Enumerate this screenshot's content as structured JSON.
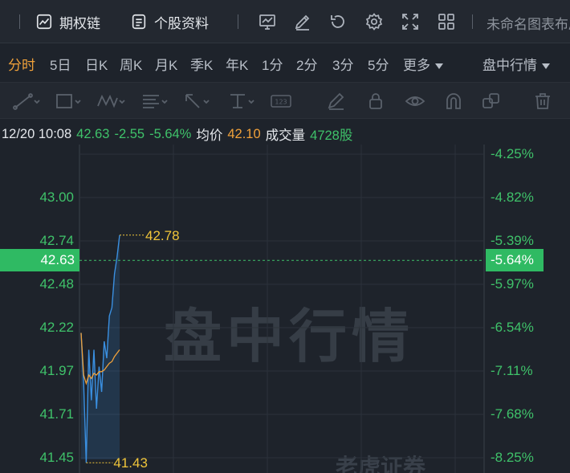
{
  "topbar": {
    "option_chain": "期权链",
    "stock_info": "个股资料",
    "layout_name": "未命名图表布局",
    "icons": [
      "chart-icon",
      "edit-icon",
      "refresh-icon",
      "settings-icon",
      "fullscreen-icon",
      "grid-icon"
    ]
  },
  "periods": {
    "items": [
      "分时",
      "5日",
      "日K",
      "周K",
      "月K",
      "季K",
      "年K",
      "1分",
      "2分",
      "3分",
      "5分",
      "更多"
    ],
    "active": "分时",
    "session": "盘中行情"
  },
  "tools": [
    "trendline-tool",
    "rectangle-tool",
    "pattern-tool",
    "fib-tool",
    "arrow-tool",
    "price-range-tool",
    "label-tool",
    "pen-tool",
    "lock-tool",
    "eye-tool",
    "magnet-tool",
    "copy-tool",
    "trash-tool"
  ],
  "info": {
    "datetime": "12/20 10:08",
    "price": "42.63",
    "change": "-2.55",
    "change_pct": "-5.64%",
    "avg_label": "均价",
    "avg_value": "42.10",
    "volume_label": "成交量",
    "volume_value": "4728股"
  },
  "watermark": "盘中行情",
  "logo_watermark": "老虎证券",
  "colors": {
    "up": "#f2525a",
    "down": "#3fc26a",
    "price_line": "#3a8fe0",
    "avg_line": "#f0a13a",
    "accent": "#f0a13a",
    "background": "#1e232b"
  },
  "chart_data": {
    "type": "line",
    "y_left_ticks": [
      "43.00",
      "42.74",
      "42.48",
      "42.22",
      "41.97",
      "41.71",
      "41.45"
    ],
    "y_right_ticks": [
      "-4.25%",
      "-4.82%",
      "-5.39%",
      "-5.97%",
      "-6.54%",
      "-7.11%",
      "-7.68%",
      "-8.25%"
    ],
    "ylim": [
      41.45,
      43.26
    ],
    "current_price": "42.63",
    "current_pct": "-5.64%",
    "high_label": "42.78",
    "low_label": "41.43",
    "series": [
      {
        "name": "",
        "values": [
          42.2,
          41.9,
          41.43,
          42.1,
          41.8,
          42.1,
          41.75,
          42.0,
          41.85,
          42.15,
          42.05,
          42.3,
          42.35,
          42.55,
          42.65,
          42.78
        ]
      },
      {
        "name": "均价",
        "values": [
          42.2,
          41.95,
          41.9,
          41.95,
          41.93,
          41.96,
          41.95,
          41.97,
          41.97,
          41.98,
          42.0,
          42.02,
          42.03,
          42.06,
          42.08,
          42.1
        ]
      }
    ]
  }
}
